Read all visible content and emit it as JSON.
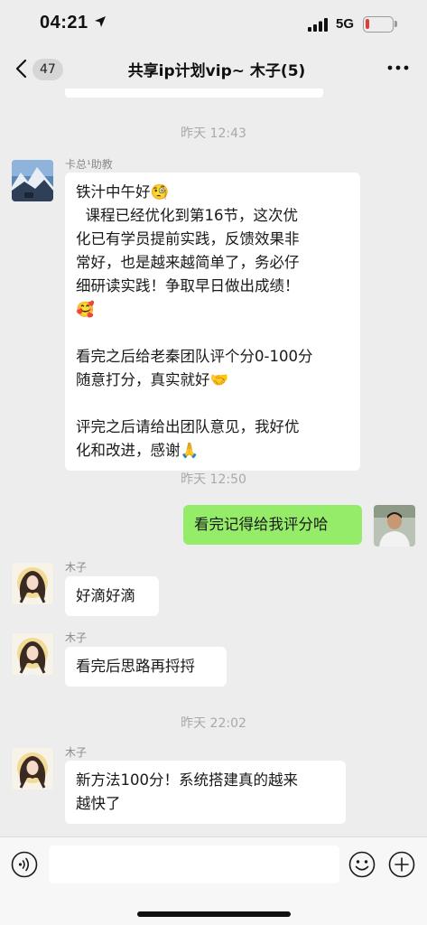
{
  "status_bar": {
    "time": "04:21",
    "network": "5G",
    "battery_level": 0.12
  },
  "nav": {
    "unread_count": "47",
    "title": "共享ip计划vip~ 木子(5)"
  },
  "colors": {
    "background": "#ededed",
    "my_bubble": "#95ec69",
    "other_bubble": "#ffffff",
    "battery_low": "#e53935"
  },
  "messages": {
    "t1": "昨天 12:43",
    "m1": {
      "sender": "卡总¹助教",
      "lines": [
        "铁汁中午好🧐",
        "  课程已经优化到第16节，这次优",
        "化已有学员提前实践，反馈效果非",
        "常好，也是越来越简单了，务必仔",
        "细研读实践！争取早日做出成绩！",
        "🥰",
        "看完之后给老秦团队评个分0-100分",
        "随意打分，真实就好🤝",
        "评完之后请给出团队意见，我好优",
        "化和改进，感谢🙏"
      ]
    },
    "t2": "昨天 12:50",
    "m2": {
      "text": "看完记得给我评分哈"
    },
    "m3": {
      "sender": "木子",
      "text": "好滴好滴"
    },
    "m4": {
      "sender": "木子",
      "text": "看完后思路再捋捋"
    },
    "t3": "昨天 22:02",
    "m5": {
      "sender": "木子",
      "lines": [
        "新方法100分！系统搭建真的越来",
        "越快了"
      ]
    }
  },
  "icons": {
    "back": "chevron-left-icon",
    "more": "more-dots-icon",
    "voice": "voice-icon",
    "emoji": "emoji-icon",
    "plus": "plus-icon"
  }
}
